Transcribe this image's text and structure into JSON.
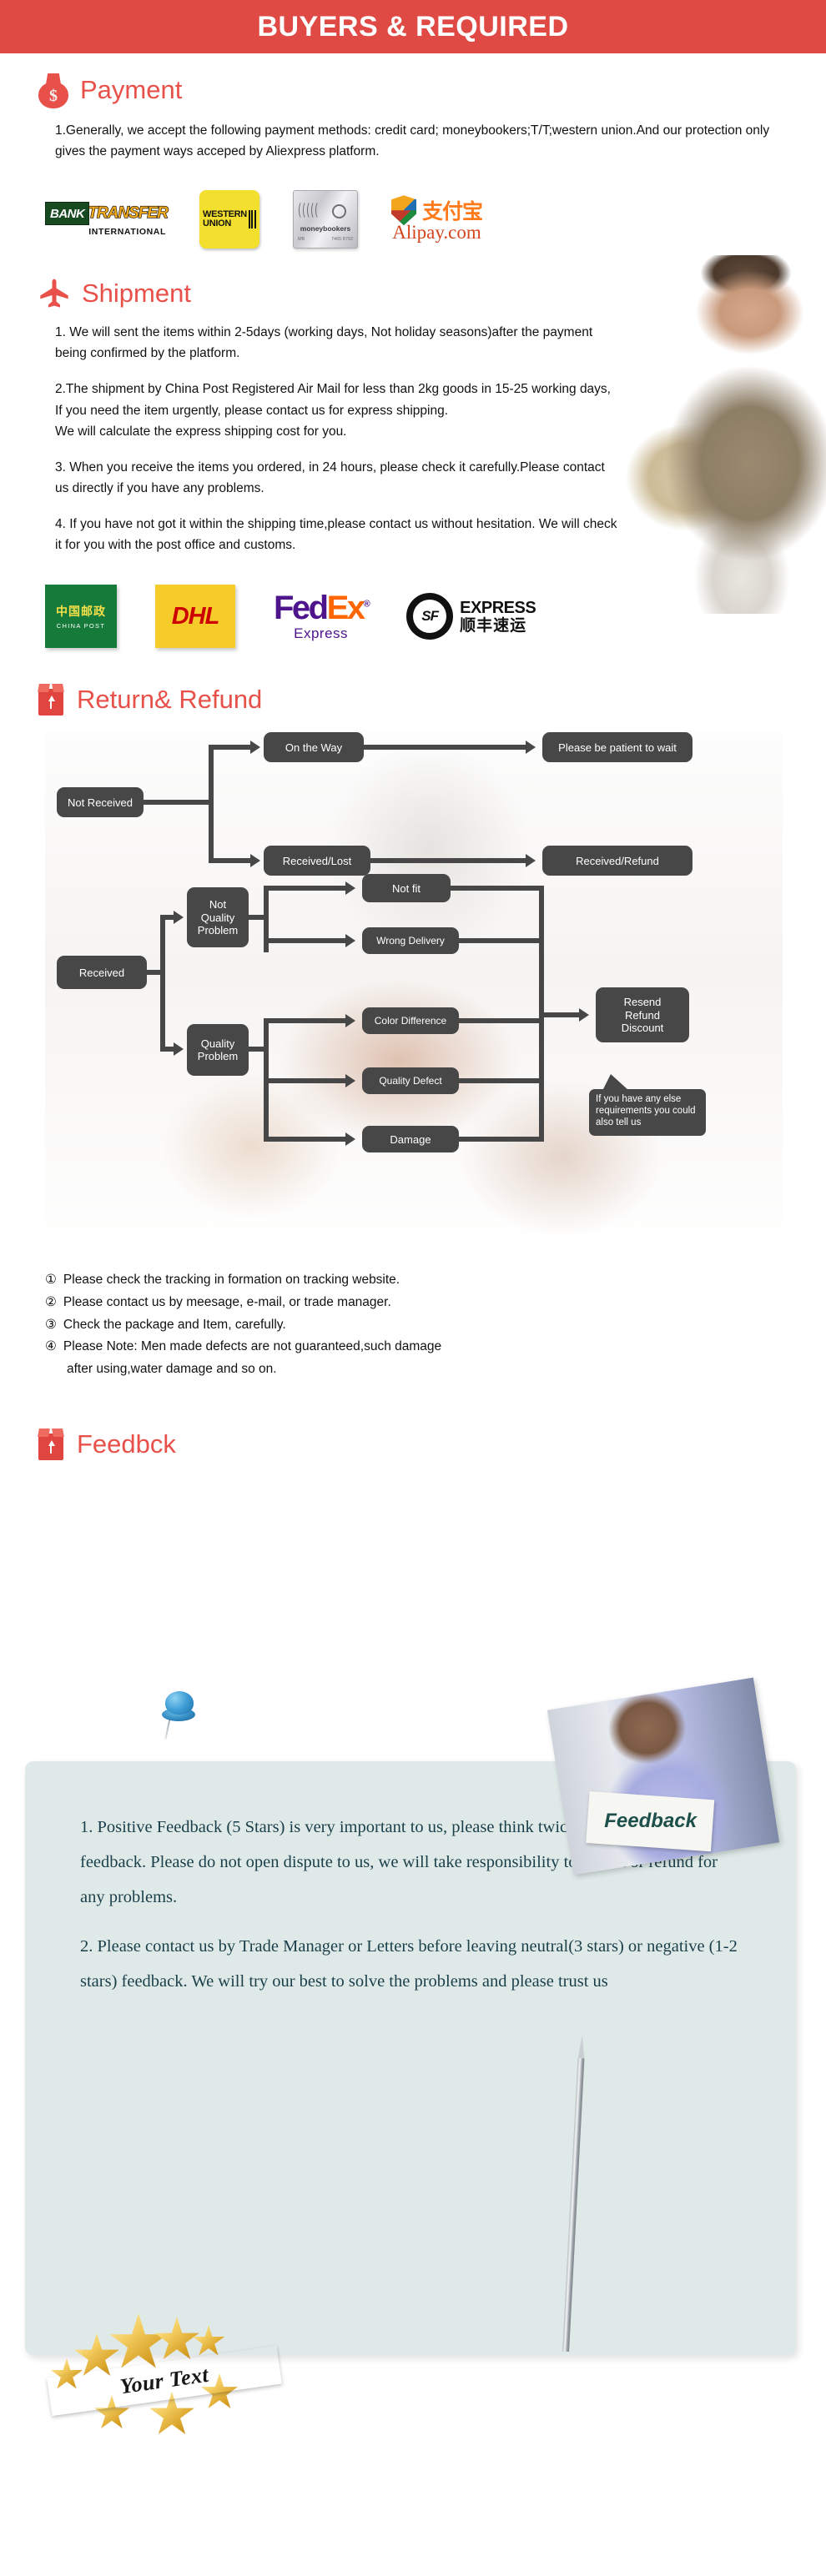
{
  "banner": {
    "title": "BUYERS & REQUIRED"
  },
  "payment": {
    "icon": "money-bag-icon",
    "heading": "Payment",
    "paragraphs": [
      "1.Generally, we accept the following payment methods: credit card; moneybookers;T/T;western union.And our protection only gives the payment ways acceped by Aliexpress platform."
    ],
    "logos": [
      {
        "id": "bank-transfer-logo",
        "name": "BANK",
        "word": "TRANSFER",
        "sub": "INTERNATIONAL"
      },
      {
        "id": "western-union-logo",
        "line1": "WESTERN",
        "line2": "UNION"
      },
      {
        "id": "moneybookers-logo",
        "label": "moneybookers",
        "micro_left": "MB",
        "micro_right": "7465 8792"
      },
      {
        "id": "alipay-logo",
        "cn": "支付宝",
        "en": "Alipay.com"
      }
    ]
  },
  "shipment": {
    "icon": "airplane-icon",
    "heading": "Shipment",
    "paragraphs": [
      "1. We will sent the items within 2-5days (working days, Not holiday seasons)after the payment being confirmed by the platform.",
      "2.The shipment by China Post Registered Air Mail for less than  2kg goods in 15-25 working days, If  you need the item urgently, please contact us for express shipping.",
      "We will calculate the express shipping cost for you.",
      "3. When you receive the items you ordered, in 24 hours, please check  it carefully.Please contact us directly if you have any problems.",
      "4. If you have not got it within the shipping time,please contact us without hesitation. We will check it for you with the post office and customs."
    ],
    "logos": [
      {
        "id": "china-post-logo",
        "cn": "中国邮政",
        "en": "CHINA POST"
      },
      {
        "id": "dhl-logo",
        "text": "DHL"
      },
      {
        "id": "fedex-logo",
        "fed": "Fed",
        "ex": "Ex",
        "reg": "®",
        "sub": "Express"
      },
      {
        "id": "sf-express-logo",
        "mark": "SF",
        "en": "EXPRESS",
        "cn": "顺丰速运"
      }
    ]
  },
  "return_refund": {
    "icon": "package-box-icon",
    "heading": "Return& Refund",
    "flowchart": {
      "nodes": {
        "not_received": "Not Received",
        "on_the_way": "On the Way",
        "please_wait": "Please be patient to wait",
        "received_lost": "Received/Lost",
        "received_refund": "Received/Refund",
        "received": "Received",
        "not_quality_problem": "Not\nQuality\nProblem",
        "quality_problem": "Quality\nProblem",
        "not_fit": "Not fit",
        "wrong_delivery": "Wrong Delivery",
        "color_difference": "Color Difference",
        "quality_defect": "Quality Defect",
        "damage": "Damage",
        "resend_refund_discount": "Resend\nRefund\nDiscount",
        "callout": "If you have any else requirements you could also tell us"
      }
    },
    "notes": [
      {
        "num": "①",
        "text": "Please check the tracking in formation on tracking website."
      },
      {
        "num": "②",
        "text": "Please contact us by meesage, e-mail, or trade manager."
      },
      {
        "num": "③",
        "text": "Check the package and Item, carefully."
      },
      {
        "num": "④",
        "text": "Please Note: Men made defects  are not guaranteed,such damage",
        "cont": "after using,water damage and so on."
      }
    ]
  },
  "feedback": {
    "icon": "package-box-icon",
    "heading": "Feedbck",
    "photo_sign_text": "Feedback",
    "paragraphs": [
      "1. Positive Feedback (5 Stars) is very important to us, please think twice before leaving feedback. Please do not open dispute to us,   we will take responsibility to resend or refund for any problems.",
      "2. Please contact us by Trade Manager or Letters before leaving neutral(3 stars) or negative (1-2 stars) feedback. We will try our best to solve the problems and please trust us"
    ],
    "badge_text": "Your Text"
  },
  "colors": {
    "brand_red": "#e04a45",
    "heading_red": "#e8504a",
    "flow_node": "#474747",
    "feedback_bg": "#dfeae8",
    "feedback_text": "#1a3f4a"
  }
}
